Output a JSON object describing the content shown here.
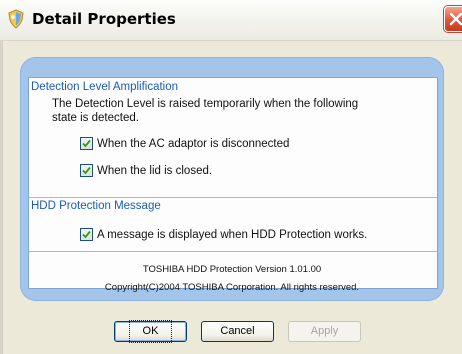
{
  "window": {
    "title": "Detail Properties",
    "icon": "shield-icon",
    "close_icon": "close-icon"
  },
  "detection": {
    "title": "Detection Level Amplification",
    "description_line1": "The Detection Level is raised temporarily when the following",
    "description_line2": "state is detected.",
    "options": [
      {
        "label": "When the AC adaptor is disconnected",
        "checked": true
      },
      {
        "label": "When the lid is closed.",
        "checked": true
      }
    ]
  },
  "hdd": {
    "title": "HDD Protection Message",
    "option": {
      "label": "A message is displayed when HDD Protection works.",
      "checked": true
    }
  },
  "footer": {
    "version": "TOSHIBA HDD Protection Version 1.01.00",
    "copyright": "Copyright(C)2004 TOSHIBA Corporation. All rights reserved."
  },
  "buttons": {
    "ok": "OK",
    "cancel": "Cancel",
    "apply": "Apply"
  },
  "colors": {
    "accent_blue": "#1c5cb6",
    "panel_blue": "#a3c5ea",
    "close_red": "#e0553b",
    "check_green": "#21a121"
  }
}
